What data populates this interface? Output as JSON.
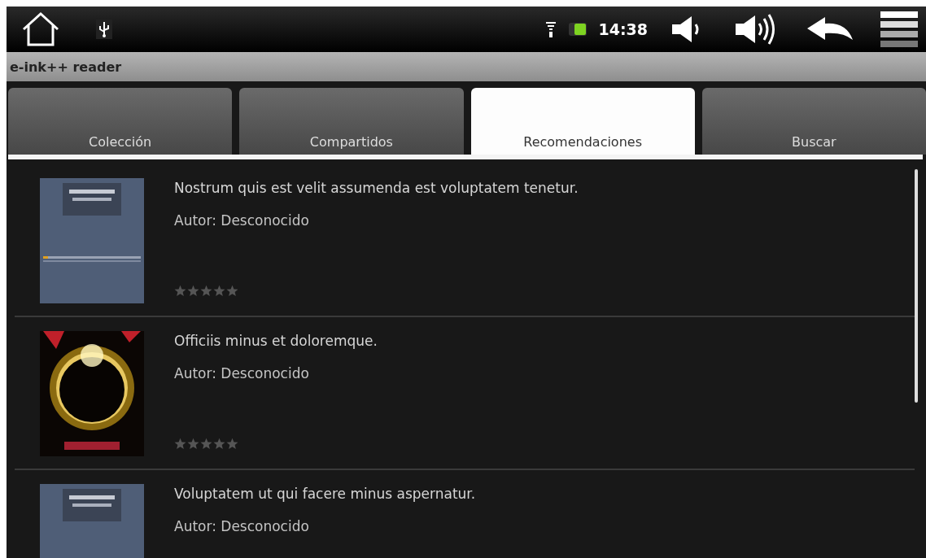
{
  "status_bar": {
    "time": "14:38"
  },
  "app_bar": {
    "title": "e-ink++ reader"
  },
  "tabs": [
    {
      "label": "Colección",
      "selected": false
    },
    {
      "label": "Compartidos",
      "selected": false
    },
    {
      "label": "Recomendaciones",
      "selected": true
    },
    {
      "label": "Buscar",
      "selected": false
    }
  ],
  "books": [
    {
      "title": "Nostrum quis est velit assumenda est voluptatem tenetur.",
      "author": "Autor: Desconocido",
      "stars": 0
    },
    {
      "title": "Officiis minus et doloremque.",
      "author": "Autor: Desconocido",
      "stars": 0
    },
    {
      "title": "Voluptatem ut qui facere minus aspernatur.",
      "author": "Autor: Desconocido"
    }
  ]
}
